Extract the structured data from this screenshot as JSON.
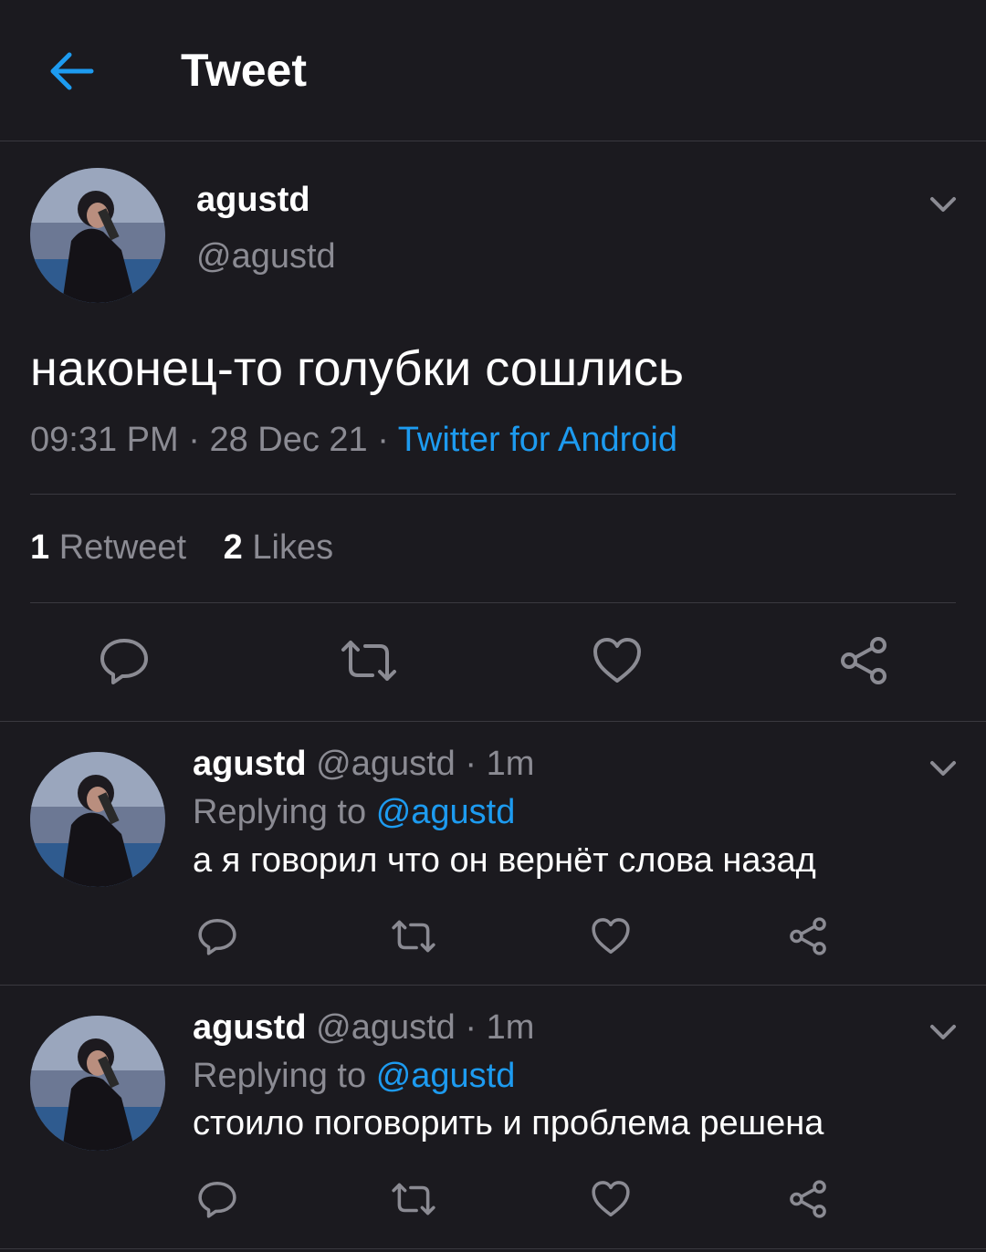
{
  "header": {
    "title": "Tweet",
    "back_icon": "arrow-left-icon",
    "accent": "#1d9bf0"
  },
  "tweet": {
    "name": "agustd",
    "handle": "@agustd",
    "text": "наконец-то голубки сошлись",
    "time": "09:31 PM",
    "date": "28 Dec 21",
    "separator": "·",
    "source": "Twitter for Android",
    "retweets_count": "1",
    "retweets_label": "Retweet",
    "likes_count": "2",
    "likes_label": "Likes"
  },
  "replies": [
    {
      "name": "agustd",
      "handle": "@agustd",
      "time": "· 1m",
      "replying_label": "Replying to",
      "replying_to": "@agustd",
      "text": "а я говорил что он вернёт слова назад"
    },
    {
      "name": "agustd",
      "handle": "@agustd",
      "time": "· 1m",
      "replying_label": "Replying to",
      "replying_to": "@agustd",
      "text": "стоило поговорить и проблема решена"
    }
  ],
  "colors": {
    "background": "#1b1a1f",
    "text": "#ffffff",
    "muted": "#8b8b93",
    "link": "#1d9bf0",
    "divider": "#3a393f"
  }
}
